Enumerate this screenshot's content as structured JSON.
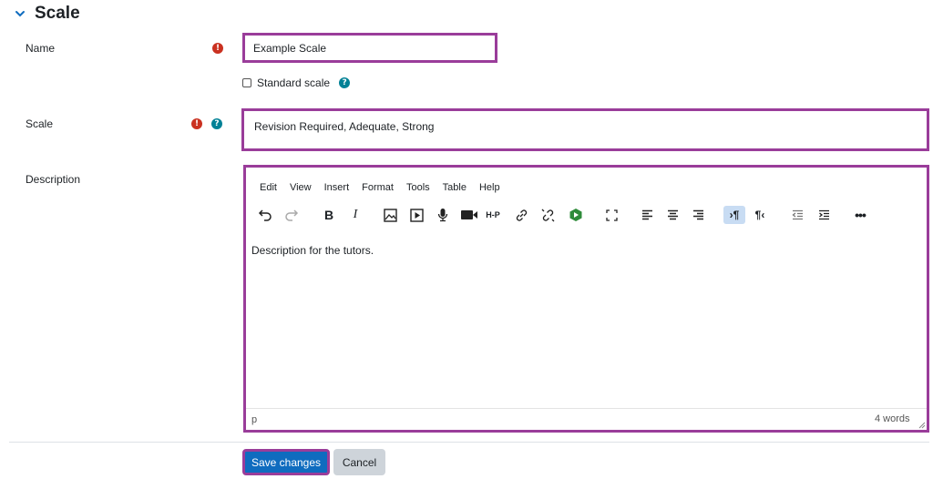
{
  "section": {
    "title": "Scale",
    "icon": "chevron-down-icon"
  },
  "name_field": {
    "label": "Name",
    "value": "Example Scale"
  },
  "standard_scale": {
    "label": "Standard scale",
    "checked": false
  },
  "scale_field": {
    "label": "Scale",
    "value": "Revision Required, Adequate, Strong"
  },
  "description": {
    "label": "Description",
    "menu": [
      "Edit",
      "View",
      "Insert",
      "Format",
      "Tools",
      "Table",
      "Help"
    ],
    "content": "Description for the tutors.",
    "statusbar_path": "p",
    "word_count": "4 words"
  },
  "buttons": {
    "save": "Save changes",
    "cancel": "Cancel"
  },
  "colors": {
    "highlight": "#9a3d9a",
    "primary": "#0f6cbf",
    "required": "#ca3120",
    "help": "#008196"
  }
}
